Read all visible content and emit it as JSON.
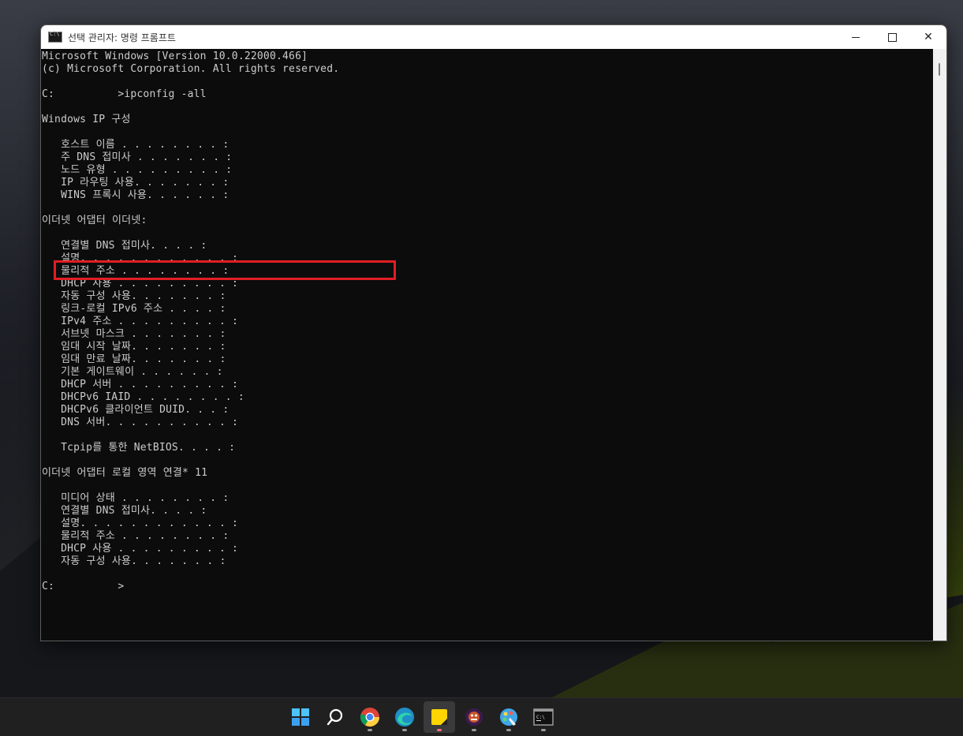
{
  "window": {
    "title": "선택 관리자: 명령 프롬프트"
  },
  "console_lines": [
    "Microsoft Windows [Version 10.0.22000.466]",
    "(c) Microsoft Corporation. All rights reserved.",
    "",
    "C:          >ipconfig -all",
    "",
    "Windows IP 구성",
    "",
    "   호스트 이름 . . . . . . . . :",
    "   주 DNS 접미사 . . . . . . . :",
    "   노드 유형 . . . . . . . . . :",
    "   IP 라우팅 사용. . . . . . . :",
    "   WINS 프록시 사용. . . . . . :",
    "",
    "이더넷 어댑터 이더넷:",
    "",
    "   연결별 DNS 접미사. . . . :",
    "   설명. . . . . . . . . . . . :",
    "   물리적 주소 . . . . . . . . :",
    "   DHCP 사용 . . . . . . . . . :",
    "   자동 구성 사용. . . . . . . :",
    "   링크-로컬 IPv6 주소 . . . . :",
    "   IPv4 주소 . . . . . . . . . :",
    "   서브넷 마스크 . . . . . . . :",
    "   임대 시작 날짜. . . . . . . :",
    "   임대 만료 날짜. . . . . . . :",
    "   기본 게이트웨이 . . . . . . :",
    "   DHCP 서버 . . . . . . . . . :",
    "   DHCPv6 IAID . . . . . . . . :",
    "   DHCPv6 클라이언트 DUID. . . :",
    "   DNS 서버. . . . . . . . . . :",
    "",
    "   Tcpip를 통한 NetBIOS. . . . :",
    "",
    "이더넷 어댑터 로컬 영역 연결* 11",
    "",
    "   미디어 상태 . . . . . . . . :",
    "   연결별 DNS 접미사. . . . :",
    "   설명. . . . . . . . . . . . :",
    "   물리적 주소 . . . . . . . . :",
    "   DHCP 사용 . . . . . . . . . :",
    "   자동 구성 사용. . . . . . . :",
    "",
    "C:          >"
  ],
  "taskbar": {
    "items": [
      "start-icon",
      "search-icon",
      "chrome-icon",
      "edge-dev-icon",
      "sticky-notes-icon",
      "game-app-icon",
      "paint-icon",
      "command-prompt-icon"
    ],
    "active": "sticky-notes-icon"
  },
  "colors": {
    "console_bg": "#0c0c0c",
    "console_text": "#cccccc",
    "highlight": "#e01e24",
    "taskbar": "#202020"
  }
}
